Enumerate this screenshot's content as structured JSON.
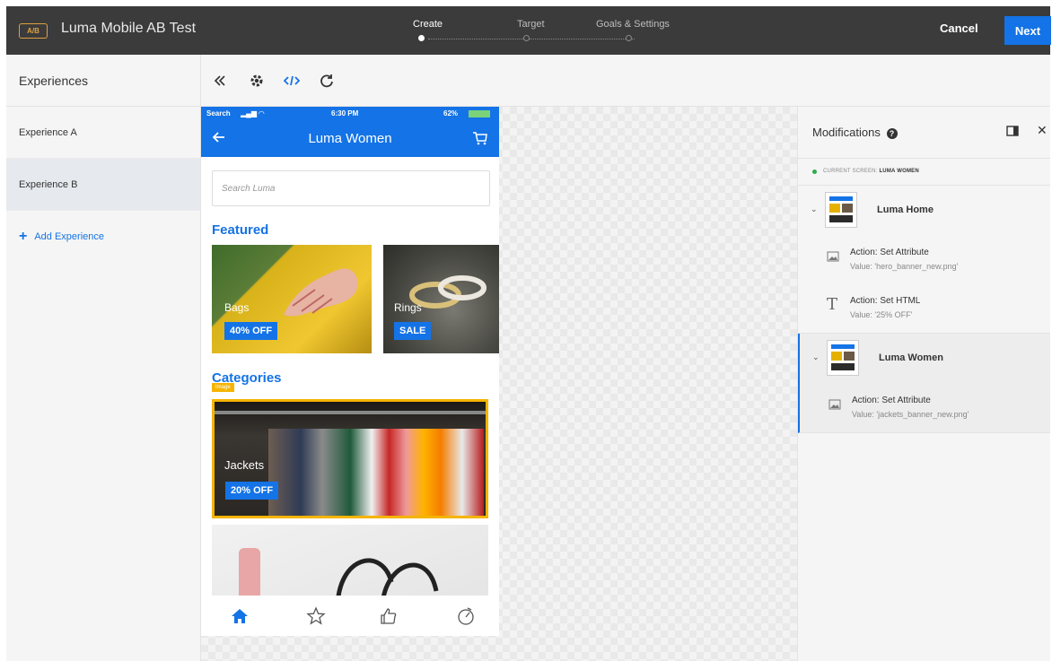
{
  "topbar": {
    "badge": "A/B",
    "title": "Luma Mobile AB Test",
    "steps": [
      "Create",
      "Target",
      "Goals & Settings"
    ],
    "active_step": 0,
    "cancel_label": "Cancel",
    "next_label": "Next",
    "accent": "#1473e6"
  },
  "sidebar": {
    "header": "Experiences",
    "items": [
      {
        "label": "Experience A",
        "selected": false
      },
      {
        "label": "Experience B",
        "selected": true
      }
    ],
    "add_label": "Add Experience"
  },
  "toolbar": {
    "icons": [
      "collapse-icon",
      "gear-icon",
      "code-icon",
      "refresh-icon"
    ]
  },
  "phone": {
    "status": {
      "carrier": "Search",
      "time": "6:30 PM",
      "battery": "62%"
    },
    "header_title": "Luma Women",
    "search_placeholder": "Search Luma",
    "featured_title": "Featured",
    "featured": [
      {
        "label": "Bags",
        "badge": "40% OFF"
      },
      {
        "label": "Rings",
        "badge": "SALE"
      }
    ],
    "categories_title": "Categories",
    "image_tag": "Image",
    "category_tile": {
      "label": "Jackets",
      "badge": "20% OFF"
    },
    "nav_icons": [
      "home-icon",
      "star-icon",
      "thumbs-up-icon",
      "timer-icon"
    ]
  },
  "modifications": {
    "title": "Modifications",
    "current_screen_label": "CURRENT SCREEN:",
    "current_screen_value": "LUMA WOMEN",
    "groups": [
      {
        "screen": "Luma Home",
        "actions": [
          {
            "icon": "image-icon",
            "title": "Action: Set Attribute",
            "value": "Value: 'hero_banner_new.png'"
          },
          {
            "icon": "text-icon",
            "title": "Action: Set HTML",
            "value": "Value: '25% OFF'"
          }
        ]
      },
      {
        "screen": "Luma Women",
        "actions": [
          {
            "icon": "image-icon",
            "title": "Action: Set Attribute",
            "value": "Value: 'jackets_banner_new.png'"
          }
        ]
      }
    ]
  }
}
